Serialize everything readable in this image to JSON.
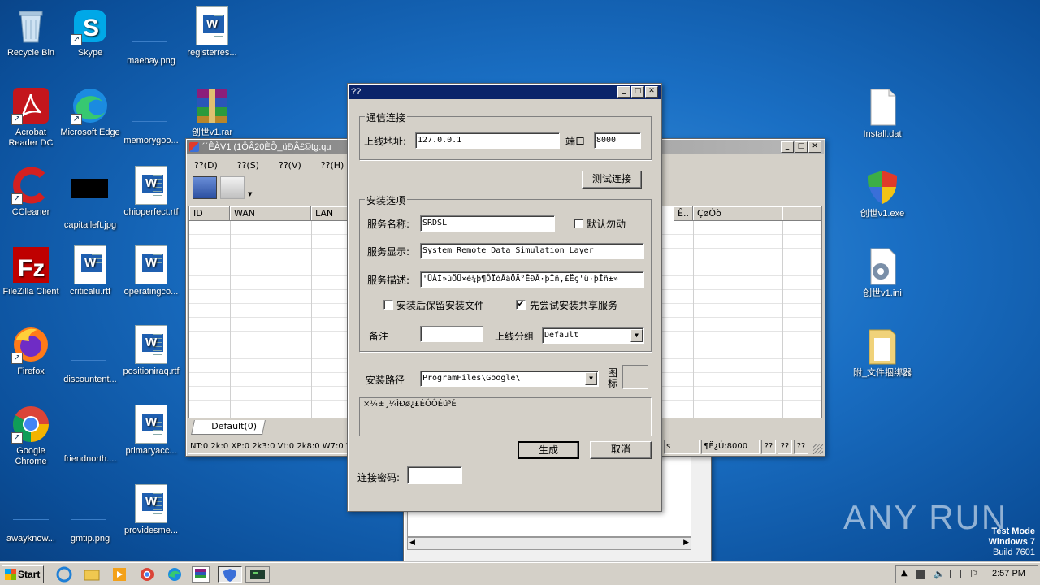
{
  "desktop": {
    "icons": [
      {
        "label": "Recycle Bin",
        "icon": "recycle-bin-icon"
      },
      {
        "label": "Skype",
        "icon": "skype-icon"
      },
      {
        "label": "maebay.png",
        "icon": "image-file-icon"
      },
      {
        "label": "registerres...",
        "icon": "word-doc-icon"
      },
      {
        "label": "Acrobat Reader DC",
        "icon": "acrobat-icon"
      },
      {
        "label": "Microsoft Edge",
        "icon": "edge-icon"
      },
      {
        "label": "memorygoo...",
        "icon": "image-file-icon"
      },
      {
        "label": "创世v1.rar",
        "icon": "winrar-icon"
      },
      {
        "label": "CCleaner",
        "icon": "ccleaner-icon"
      },
      {
        "label": "capitalleft.jpg",
        "icon": "image-file-icon"
      },
      {
        "label": "ohioperfect.rtf",
        "icon": "word-doc-icon"
      },
      {
        "label": "FileZilla Client",
        "icon": "filezilla-icon"
      },
      {
        "label": "criticalu.rtf",
        "icon": "word-doc-icon"
      },
      {
        "label": "operatingco...",
        "icon": "word-doc-icon"
      },
      {
        "label": "Firefox",
        "icon": "firefox-icon"
      },
      {
        "label": "discountent...",
        "icon": "image-file-icon"
      },
      {
        "label": "positioniraq.rtf",
        "icon": "word-doc-icon"
      },
      {
        "label": "Google Chrome",
        "icon": "chrome-icon"
      },
      {
        "label": "friendnorth....",
        "icon": "image-file-icon"
      },
      {
        "label": "primaryacc...",
        "icon": "word-doc-icon"
      },
      {
        "label": "awayknow...",
        "icon": "image-file-icon"
      },
      {
        "label": "gmtip.png",
        "icon": "image-file-icon"
      },
      {
        "label": "providesme...",
        "icon": "word-doc-icon"
      },
      {
        "label": "Install.dat",
        "icon": "blank-file-icon"
      },
      {
        "label": "创世v1.exe",
        "icon": "shield-exe-icon"
      },
      {
        "label": "创世v1.ini",
        "icon": "settings-file-icon"
      },
      {
        "label": "附_文件捆绑器",
        "icon": "folder-file-icon"
      }
    ]
  },
  "main_window": {
    "title": "´´ÊÀV1 (1ÔÂ20ÈÕ_üÐÂ£©tg:qu",
    "menu": [
      "??(D)",
      "??(S)",
      "??(V)",
      "??(H)"
    ],
    "columns": [
      "ID",
      "WAN",
      "LAN",
      "Ê..",
      "ÇøÓò"
    ],
    "tab_label": "Default(0)",
    "status_left": "NT:0 2k:0 XP:0 2k3:0 Vt:0 2k8:0 W7:0 W",
    "status_s": "s",
    "status_port": "¶Ë¿Ú:8000",
    "status_q": [
      "??",
      "??",
      "??"
    ]
  },
  "dialog": {
    "title": "??",
    "comm_group": "通信连接",
    "online_addr_label": "上线地址:",
    "online_addr_value": "127.0.0.1",
    "port_label": "端口",
    "port_value": "8000",
    "test_button": "测试连接",
    "install_group": "安装选项",
    "service_name_label": "服务名称:",
    "service_name_value": "SRDSL",
    "default_start_label": "默认勿动",
    "default_start_checked": false,
    "service_display_label": "服务显示:",
    "service_display_value": "System Remote Data Simulation Layer",
    "service_desc_label": "服务描述:",
    "service_desc_value": "'ÜÀÍ»úÖÜ×é¼þ¶ÔÏóÅäÖÃ°ÊÐÂ·þÎñ,£Ëç'û·þÎñ±»",
    "keep_files_label": "安装后保留安装文件",
    "keep_files_checked": false,
    "try_shared_label": "先尝试安装共享服务",
    "try_shared_checked": true,
    "remark_label": "备注",
    "remark_value": "",
    "group_label": "上线分组",
    "group_value": "Default",
    "install_path_label": "安装路径",
    "install_path_value": "ProgramFiles\\Google\\",
    "icon_label": "图标",
    "log_text": "×¼±¸¼ÌÐø¿£ÉÓÔÉú³É",
    "generate_button": "生成",
    "cancel_button": "取消",
    "password_label": "连接密码:",
    "password_value": ""
  },
  "taskbar": {
    "start_label": "Start",
    "clock": "2:57 PM"
  },
  "watermark": {
    "brand": "ANY RUN",
    "line1": "Test Mode",
    "line2": "Windows 7",
    "line3": "Build 7601"
  }
}
